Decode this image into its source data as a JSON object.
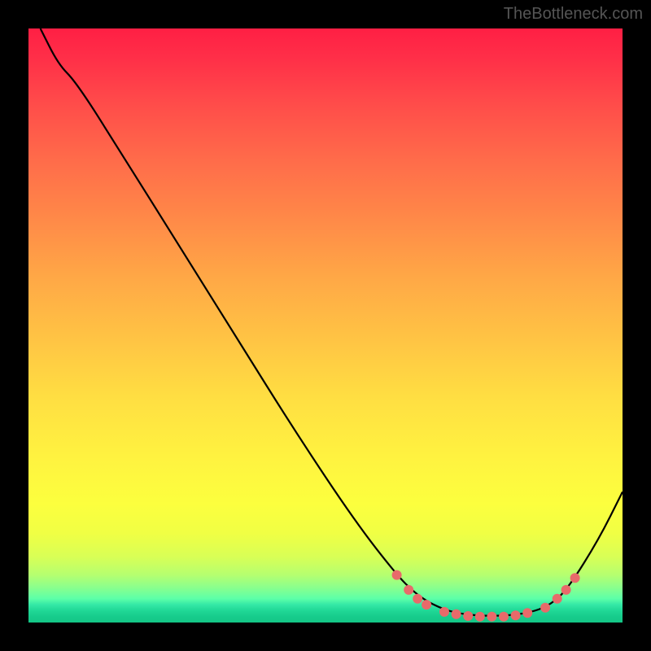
{
  "watermark": "TheBottleneck.com",
  "chart_data": {
    "type": "line",
    "title": "",
    "xlabel": "",
    "ylabel": "",
    "xlim": [
      0,
      100
    ],
    "ylim": [
      0,
      100
    ],
    "curve": [
      {
        "x": 2,
        "y": 100
      },
      {
        "x": 5,
        "y": 94
      },
      {
        "x": 8,
        "y": 91
      },
      {
        "x": 15,
        "y": 80
      },
      {
        "x": 25,
        "y": 64
      },
      {
        "x": 35,
        "y": 48
      },
      {
        "x": 45,
        "y": 32
      },
      {
        "x": 55,
        "y": 17
      },
      {
        "x": 62,
        "y": 8
      },
      {
        "x": 65,
        "y": 5
      },
      {
        "x": 68,
        "y": 3
      },
      {
        "x": 72,
        "y": 1.5
      },
      {
        "x": 78,
        "y": 1
      },
      {
        "x": 84,
        "y": 1.5
      },
      {
        "x": 88,
        "y": 3
      },
      {
        "x": 91,
        "y": 6
      },
      {
        "x": 96,
        "y": 14
      },
      {
        "x": 100,
        "y": 22
      }
    ],
    "markers": [
      {
        "x": 62,
        "y": 8
      },
      {
        "x": 64,
        "y": 5.5
      },
      {
        "x": 65.5,
        "y": 4
      },
      {
        "x": 67,
        "y": 3
      },
      {
        "x": 70,
        "y": 1.8
      },
      {
        "x": 72,
        "y": 1.4
      },
      {
        "x": 74,
        "y": 1.1
      },
      {
        "x": 76,
        "y": 1
      },
      {
        "x": 78,
        "y": 1
      },
      {
        "x": 80,
        "y": 1
      },
      {
        "x": 82,
        "y": 1.2
      },
      {
        "x": 84,
        "y": 1.6
      },
      {
        "x": 87,
        "y": 2.5
      },
      {
        "x": 89,
        "y": 4
      },
      {
        "x": 90.5,
        "y": 5.5
      },
      {
        "x": 92,
        "y": 7.5
      }
    ],
    "gradient_stops": [
      {
        "pos": 0,
        "color": "#ff1f44"
      },
      {
        "pos": 50,
        "color": "#ffc344"
      },
      {
        "pos": 80,
        "color": "#fcff3e"
      },
      {
        "pos": 100,
        "color": "#14c686"
      }
    ]
  }
}
